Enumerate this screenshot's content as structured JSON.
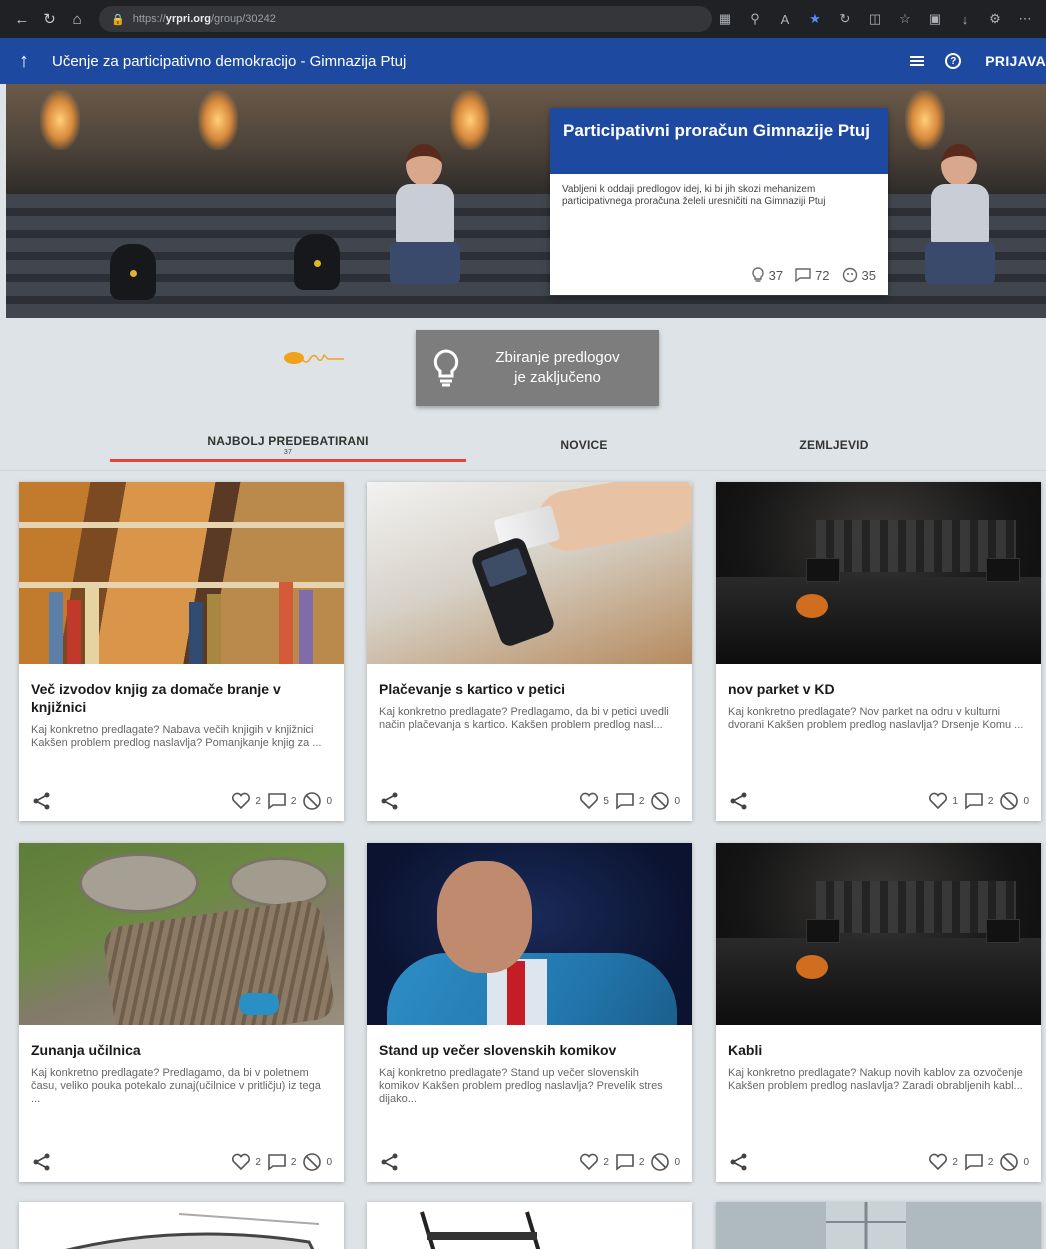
{
  "browser": {
    "url_prefix": "https://",
    "url_host": "yrpri.org",
    "url_path": "/group/30242"
  },
  "app_bar": {
    "title": "Učenje za participativno demokracijo - Gimnazija Ptuj",
    "login_label": "PRIJAVA"
  },
  "hero": {
    "title": "Participativni proračun Gimnazije Ptuj",
    "description": "Vabljeni k oddaji predlogov idej, ki bi jih skozi mehanizem participativnega proračuna želeli uresničiti na Gimnaziji Ptuj",
    "ideas_count": "37",
    "comments_count": "72",
    "users_count": "35"
  },
  "status_button": {
    "line1": "Zbiranje predlogov",
    "line2": "je zaključeno"
  },
  "tabs": [
    {
      "label": "NAJBOLJ PREDEBATIRANI",
      "count": "37"
    },
    {
      "label": "NOVICE"
    },
    {
      "label": "ZEMLJEVID"
    }
  ],
  "cards": [
    {
      "title": "Več izvodov knjig za domače branje v knjižnici",
      "desc": "Kaj konkretno predlagate? Nabava večih knjigih v knjižnici Kakšen problem predlog naslavlja? Pomanjkanje knjig za ...",
      "likes": "2",
      "comments": "2",
      "dislikes": "0"
    },
    {
      "title": "Plačevanje s kartico v petici",
      "desc": "Kaj konkretno predlagate? Predlagamo, da bi v petici uvedli način plačevanja s kartico. Kakšen problem predlog nasl...",
      "likes": "5",
      "comments": "2",
      "dislikes": "0"
    },
    {
      "title": "nov parket v KD",
      "desc": "Kaj konkretno predlagate? Nov parket na odru v kulturni dvorani Kakšen problem predlog naslavlja? Drsenje Komu ...",
      "likes": "1",
      "comments": "2",
      "dislikes": "0"
    },
    {
      "title": "Zunanja učilnica",
      "desc": "Kaj konkretno predlagate? Predlagamo, da bi v poletnem času, veliko pouka potekalo zunaj(učilnice v pritličju) iz tega ...",
      "likes": "2",
      "comments": "2",
      "dislikes": "0"
    },
    {
      "title": "Stand up večer slovenskih komikov",
      "desc": "Kaj konkretno predlagate? Stand up večer slovenskih komikov Kakšen problem predlog naslavlja? Prevelik stres dijako...",
      "likes": "2",
      "comments": "2",
      "dislikes": "0"
    },
    {
      "title": "Kabli",
      "desc": "Kaj konkretno predlagate? Nakup novih kablov za ozvočenje Kakšen problem predlog naslavlja? Zaradi obrabljenih kabl...",
      "likes": "2",
      "comments": "2",
      "dislikes": "0"
    }
  ],
  "colors": {
    "app_bar": "#1d4aa0",
    "tab_indicator": "#e4423a",
    "status_button": "#7d7d7d",
    "page_background": "#dde3e6"
  },
  "icons": [
    "back-icon",
    "refresh-icon",
    "home-icon",
    "lock-icon",
    "star-icon",
    "arrow-up-icon",
    "menu-icon",
    "help-icon",
    "lightbulb-icon",
    "comment-icon",
    "users-icon",
    "share-icon",
    "heart-icon",
    "block-icon"
  ]
}
